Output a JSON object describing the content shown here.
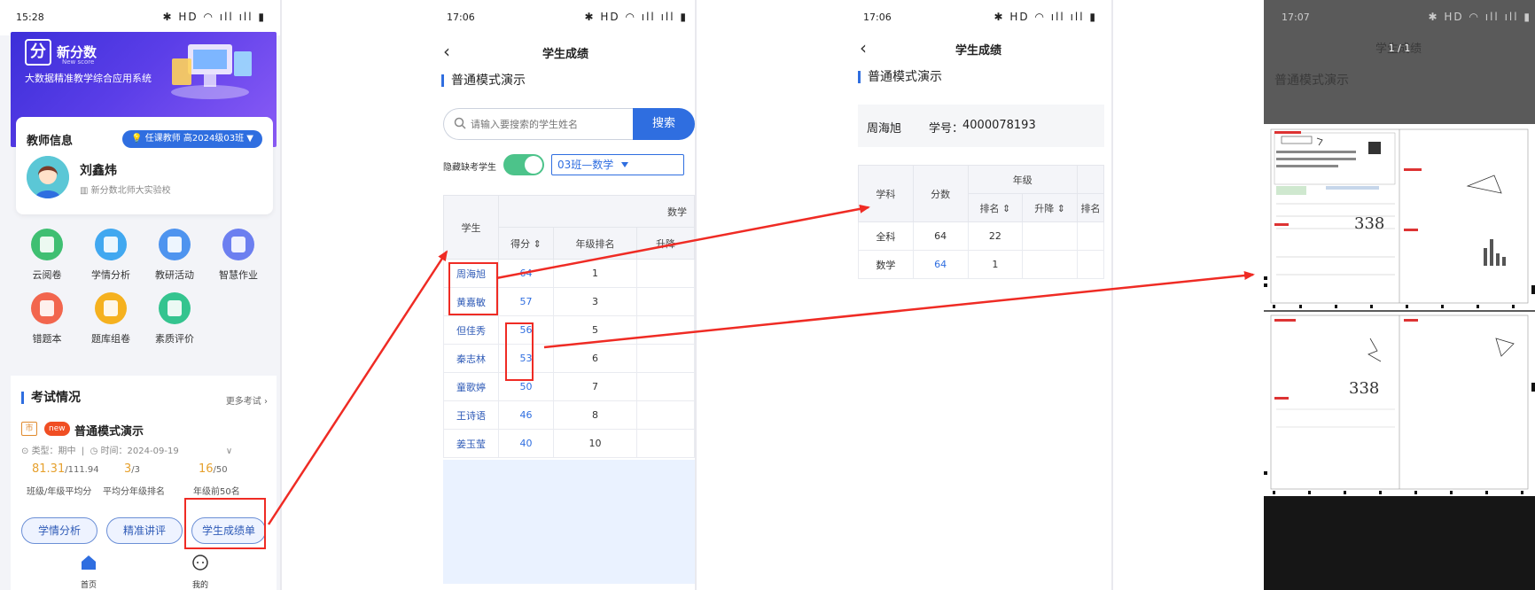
{
  "screen1": {
    "status_time": "15:28",
    "status_icons": "✱ HD ◠ ıll ıll ▮",
    "brand": "新分数",
    "brand_sub": "New score",
    "tagline": "大数据精准教学综合应用系统",
    "teacher_info_title": "教师信息",
    "teacher_role_pill": "💡 任课教师 高2024级03班",
    "teacher_name": "刘鑫炜",
    "teacher_school": "新分数北师大实验校",
    "features": [
      {
        "label": "云阅卷",
        "color": "#3fbf72"
      },
      {
        "label": "学情分析",
        "color": "#41a8f0"
      },
      {
        "label": "教研活动",
        "color": "#4e94ef"
      },
      {
        "label": "智慧作业",
        "color": "#6c7ff0"
      },
      {
        "label": "错题本",
        "color": "#f2664e"
      },
      {
        "label": "题库组卷",
        "color": "#f5b11f"
      },
      {
        "label": "素质评价",
        "color": "#34c48f"
      }
    ],
    "exam_section_title": "考试情况",
    "more_exams": "更多考试 ›",
    "badge_city": "市",
    "badge_new": "new",
    "exam_name": "普通模式演示",
    "exam_type": "类型：期中",
    "exam_time": "时间：2024-09-19",
    "stat1_value": "81.31",
    "stat1_total": "/111.94",
    "stat1_label": "班级/年级平均分",
    "stat2_value": "3",
    "stat2_total": "/3",
    "stat2_label": "平均分年级排名",
    "stat3_value": "16",
    "stat3_total": "/50",
    "stat3_label": "年级前50名",
    "btn_analysis": "学情分析",
    "btn_review": "精准讲评",
    "btn_report": "学生成绩单",
    "tab_home": "首页",
    "tab_mine": "我的"
  },
  "screen2": {
    "status_time": "17:06",
    "status_icons": "✱ HD ◠ ıll ıll ▮",
    "nav_title": "学生成绩",
    "section_title": "普通模式演示",
    "search_placeholder": "请输入要搜索的学生姓名",
    "search_button": "搜索",
    "toggle_label": "隐藏缺考学生",
    "class_select": "03班—数学",
    "table": {
      "col_student": "学生",
      "col_subject": "数学",
      "col_score": "得分 ⇕",
      "col_grade_rank": "年级排名",
      "col_change": "升降",
      "rows": [
        {
          "name": "周海旭",
          "score": "64",
          "rank": "1"
        },
        {
          "name": "黄嘉敏",
          "score": "57",
          "rank": "3"
        },
        {
          "name": "但佳秀",
          "score": "56",
          "rank": "5"
        },
        {
          "name": "秦志林",
          "score": "53",
          "rank": "6"
        },
        {
          "name": "童歌婷",
          "score": "50",
          "rank": "7"
        },
        {
          "name": "王诗语",
          "score": "46",
          "rank": "8"
        },
        {
          "name": "姜玉莹",
          "score": "40",
          "rank": "10"
        }
      ]
    }
  },
  "screen3": {
    "status_time": "17:06",
    "status_icons": "✱ HD ◠ ıll ıll ▮",
    "nav_title": "学生成绩",
    "section_title": "普通模式演示",
    "student_name": "周海旭",
    "student_id_label": "学号：",
    "student_id": "4000078193",
    "table": {
      "col_subject": "学科",
      "col_score": "分数",
      "col_grade": "年级",
      "col_rank": "排名 ⇕",
      "col_change": "升降 ⇕",
      "col_rank2": "排名",
      "rows": [
        {
          "subject": "全科",
          "score": "64",
          "rank": "22"
        },
        {
          "subject": "数学",
          "score": "64",
          "rank": "1"
        }
      ]
    }
  },
  "screen4": {
    "status_time": "17:07",
    "status_icons": "✱ HD ◠ ıll ıll ▮",
    "pager": "1 / 1",
    "bg_title": "学生成绩",
    "bg_section": "普通模式演示",
    "handwritten_1": "338",
    "handwritten_2": "338"
  },
  "colors": {
    "accent": "#2f6ee0",
    "annotation_red": "#ef2b24",
    "toggle_on": "#4cc38a",
    "stat_orange": "#e6a12e"
  }
}
